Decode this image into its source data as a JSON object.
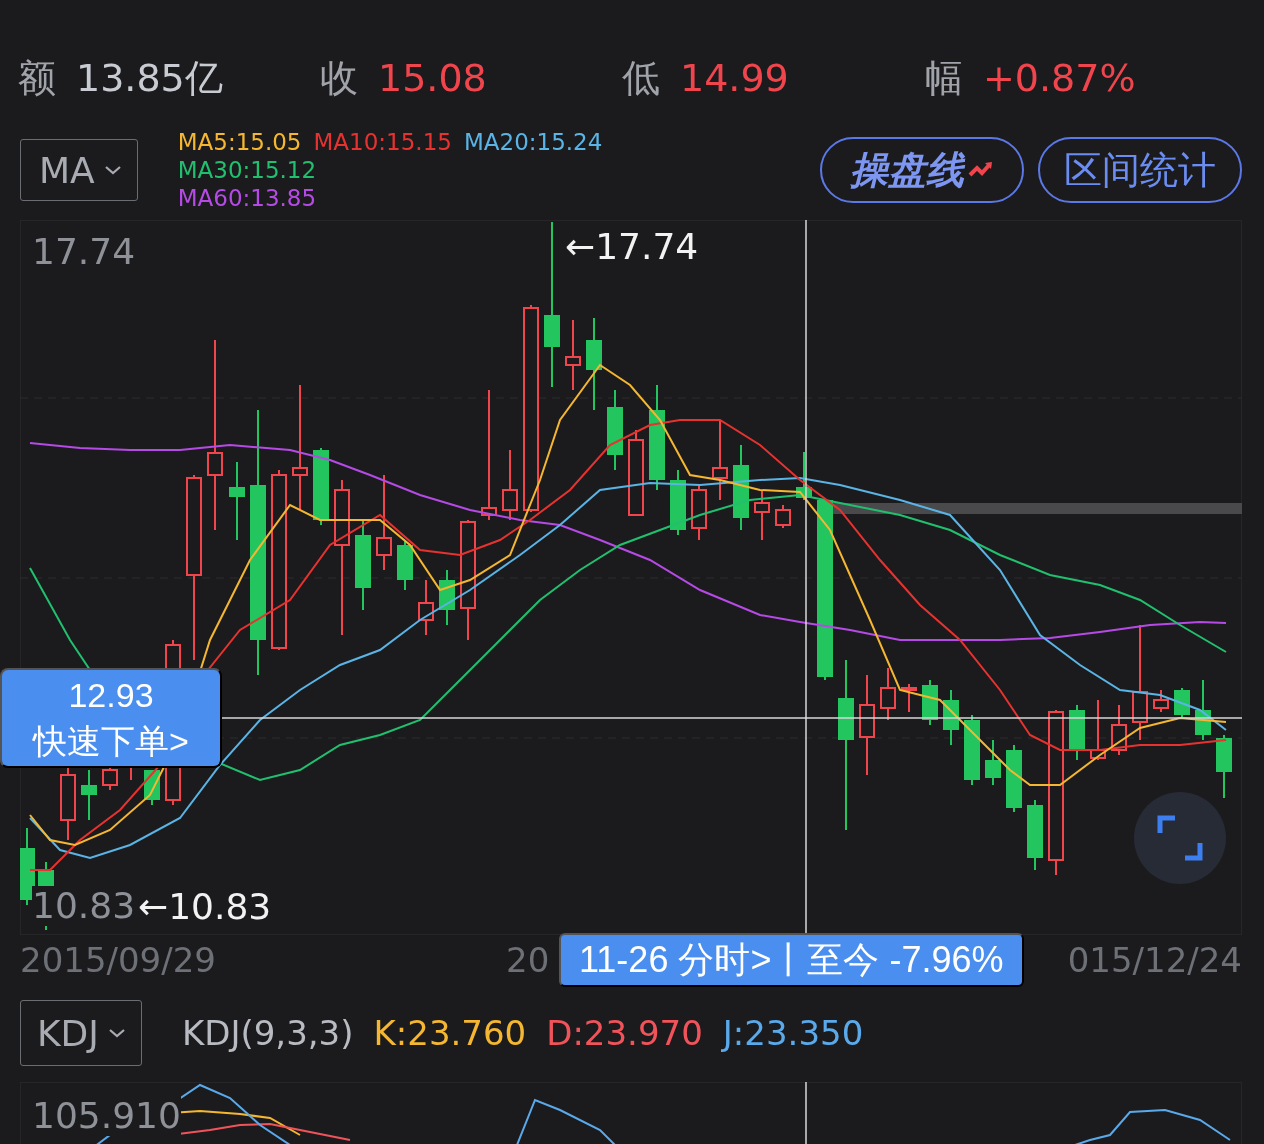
{
  "stats": [
    {
      "label": "额",
      "value": "13.85亿",
      "color": "#c8ccd2"
    },
    {
      "label": "收",
      "value": "15.08",
      "color": "#f0454d"
    },
    {
      "label": "低",
      "value": "14.99",
      "color": "#f0454d"
    },
    {
      "label": "幅",
      "value": "+0.87%",
      "color": "#f0454d"
    }
  ],
  "indicator_bar": {
    "selector": "MA",
    "legend_rows": [
      [
        {
          "text": "MA5:15.05",
          "color": "#f5b731"
        },
        {
          "text": "MA10:15.15",
          "color": "#e8322f"
        },
        {
          "text": "MA20:15.24",
          "color": "#5ab4e5"
        }
      ],
      [
        {
          "text": "MA30:15.12",
          "color": "#21c06f"
        }
      ],
      [
        {
          "text": "MA60:13.85",
          "color": "#b64ae6"
        }
      ]
    ],
    "buttons": [
      {
        "label": "操盘线",
        "kind": "brand"
      },
      {
        "label": "区间统计",
        "kind": "outline"
      }
    ]
  },
  "price_chart": {
    "high_label": "17.74",
    "high_marker": "←17.74",
    "low_label": "10.83",
    "low_marker": "←10.83",
    "crosshair_tag": {
      "price": "12.93",
      "action": "快速下单>"
    },
    "date_labels": [
      "2015/09/29",
      "20",
      "015/12/24"
    ],
    "tooltip": "11-26 分时>丨至今 -7.96%"
  },
  "kdj": {
    "selector": "KDJ",
    "legend": [
      {
        "text": "KDJ(9,3,3)",
        "color": "#b8bcc2"
      },
      {
        "text": "K:23.760",
        "color": "#f5b731"
      },
      {
        "text": "D:23.970",
        "color": "#f0545a"
      },
      {
        "text": "J:23.350",
        "color": "#5aa9ea"
      }
    ],
    "top_label": "105.910"
  }
}
